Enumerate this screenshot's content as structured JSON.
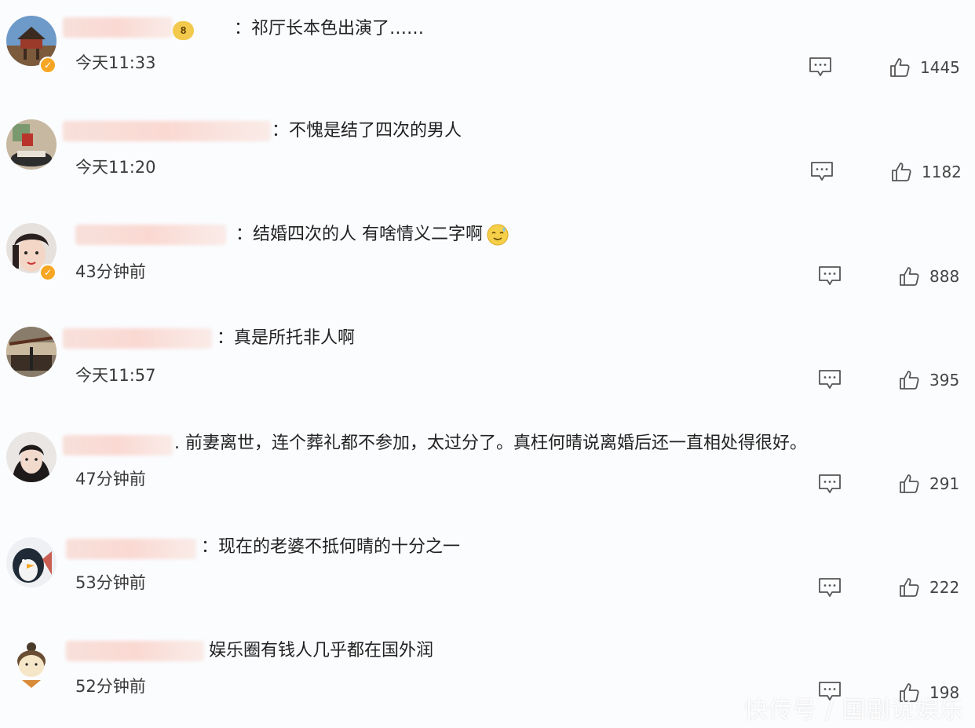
{
  "comments": [
    {
      "text": "：祁厅长本色出演了……",
      "time": "今天11:33",
      "likes": "1445",
      "verified": true,
      "badge": "8"
    },
    {
      "text": "：不愧是结了四次的男人",
      "time": "今天11:20",
      "likes": "1182",
      "verified": false
    },
    {
      "text": "：结婚四次的人 有啥情义二字啊",
      "time": "43分钟前",
      "likes": "888",
      "verified": true,
      "emoji": "sweat-smile-emoji"
    },
    {
      "text": "：真是所托非人啊",
      "time": "今天11:57",
      "likes": "395",
      "verified": false
    },
    {
      "text": ". 前妻离世，连个葬礼都不参加，太过分了。真枉何晴说离婚后还一直相处得很好。",
      "time": "47分钟前",
      "likes": "291",
      "verified": false
    },
    {
      "text": "：现在的老婆不抵何晴的十分之一",
      "time": "53分钟前",
      "likes": "222",
      "verified": false
    },
    {
      "text": "娱乐圈有钱人几乎都在国外润",
      "time": "52分钟前",
      "likes": "198",
      "verified": false
    }
  ],
  "watermark": "快传号 / 国剧说娱乐",
  "icons": {
    "reply": "comment-bubble-icon",
    "like": "thumbs-up-icon",
    "verified": "verified-check-icon"
  },
  "colors": {
    "background": "#fbfcfe",
    "verified": "#f6a623",
    "name_blur": "#f8cfc4"
  }
}
